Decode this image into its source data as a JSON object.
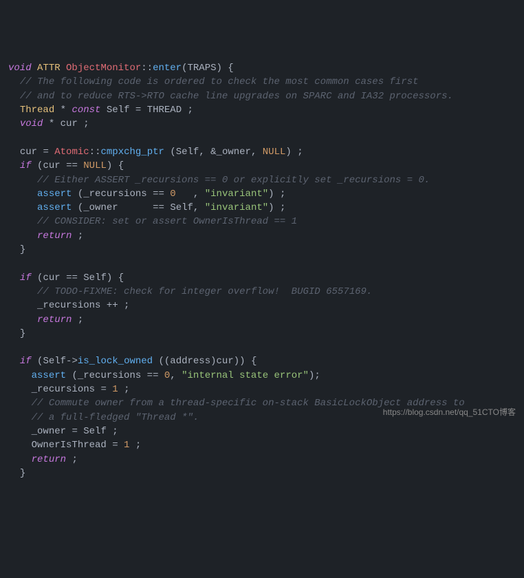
{
  "code": {
    "l1_void": "void",
    "l1_attr": "ATTR",
    "l1_obj": "ObjectMonitor",
    "l1_enter": "enter",
    "l1_traps": "TRAPS",
    "l2_cm": "// The following code is ordered to check the most common cases first",
    "l3_cm": "// and to reduce RTS->RTO cache line upgrades on SPARC and IA32 processors.",
    "l4_thread": "Thread",
    "l4_const": "const",
    "l4_self": "Self",
    "l4_thr": "THREAD",
    "l5_void": "void",
    "l5_cur": "cur",
    "l7_cur": "cur",
    "l7_atomic": "Atomic",
    "l7_cmpx": "cmpxchg_ptr",
    "l7_self": "Self",
    "l7_owner": "_owner",
    "l7_null": "NULL",
    "l8_if": "if",
    "l8_cur": "cur",
    "l8_null": "NULL",
    "l9_cm": "// Either ASSERT _recursions == 0 or explicitly set _recursions = 0.",
    "l10_assert": "assert",
    "l10_rec": "_recursions",
    "l10_zero": "0",
    "l10_inv": "\"invariant\"",
    "l11_assert": "assert",
    "l11_owner": "_owner",
    "l11_self": "Self",
    "l11_inv": "\"invariant\"",
    "l12_cm": "// CONSIDER: set or assert OwnerIsThread == 1",
    "l13_ret": "return",
    "l16_if": "if",
    "l16_cur": "cur",
    "l16_self": "Self",
    "l17_cm": "// TODO-FIXME: check for integer overflow!  BUGID 6557169.",
    "l18_rec": "_recursions",
    "l19_ret": "return",
    "l22_if": "if",
    "l22_self": "Self",
    "l22_ilo": "is_lock_owned",
    "l22_addr": "address",
    "l22_cur": "cur",
    "l23_assert": "assert",
    "l23_rec": "_recursions",
    "l23_zero": "0",
    "l23_err": "\"internal state error\"",
    "l24_rec": "_recursions",
    "l24_one": "1",
    "l25_cm": "// Commute owner from a thread-specific on-stack BasicLockObject address to",
    "l26_cm": "// a full-fledged \"Thread *\".",
    "l27_owner": "_owner",
    "l27_self": "Self",
    "l28_oit": "OwnerIsThread",
    "l28_one": "1",
    "l29_ret": "return"
  },
  "watermark": "https://blog.csdn.net/qq_51CTO博客"
}
